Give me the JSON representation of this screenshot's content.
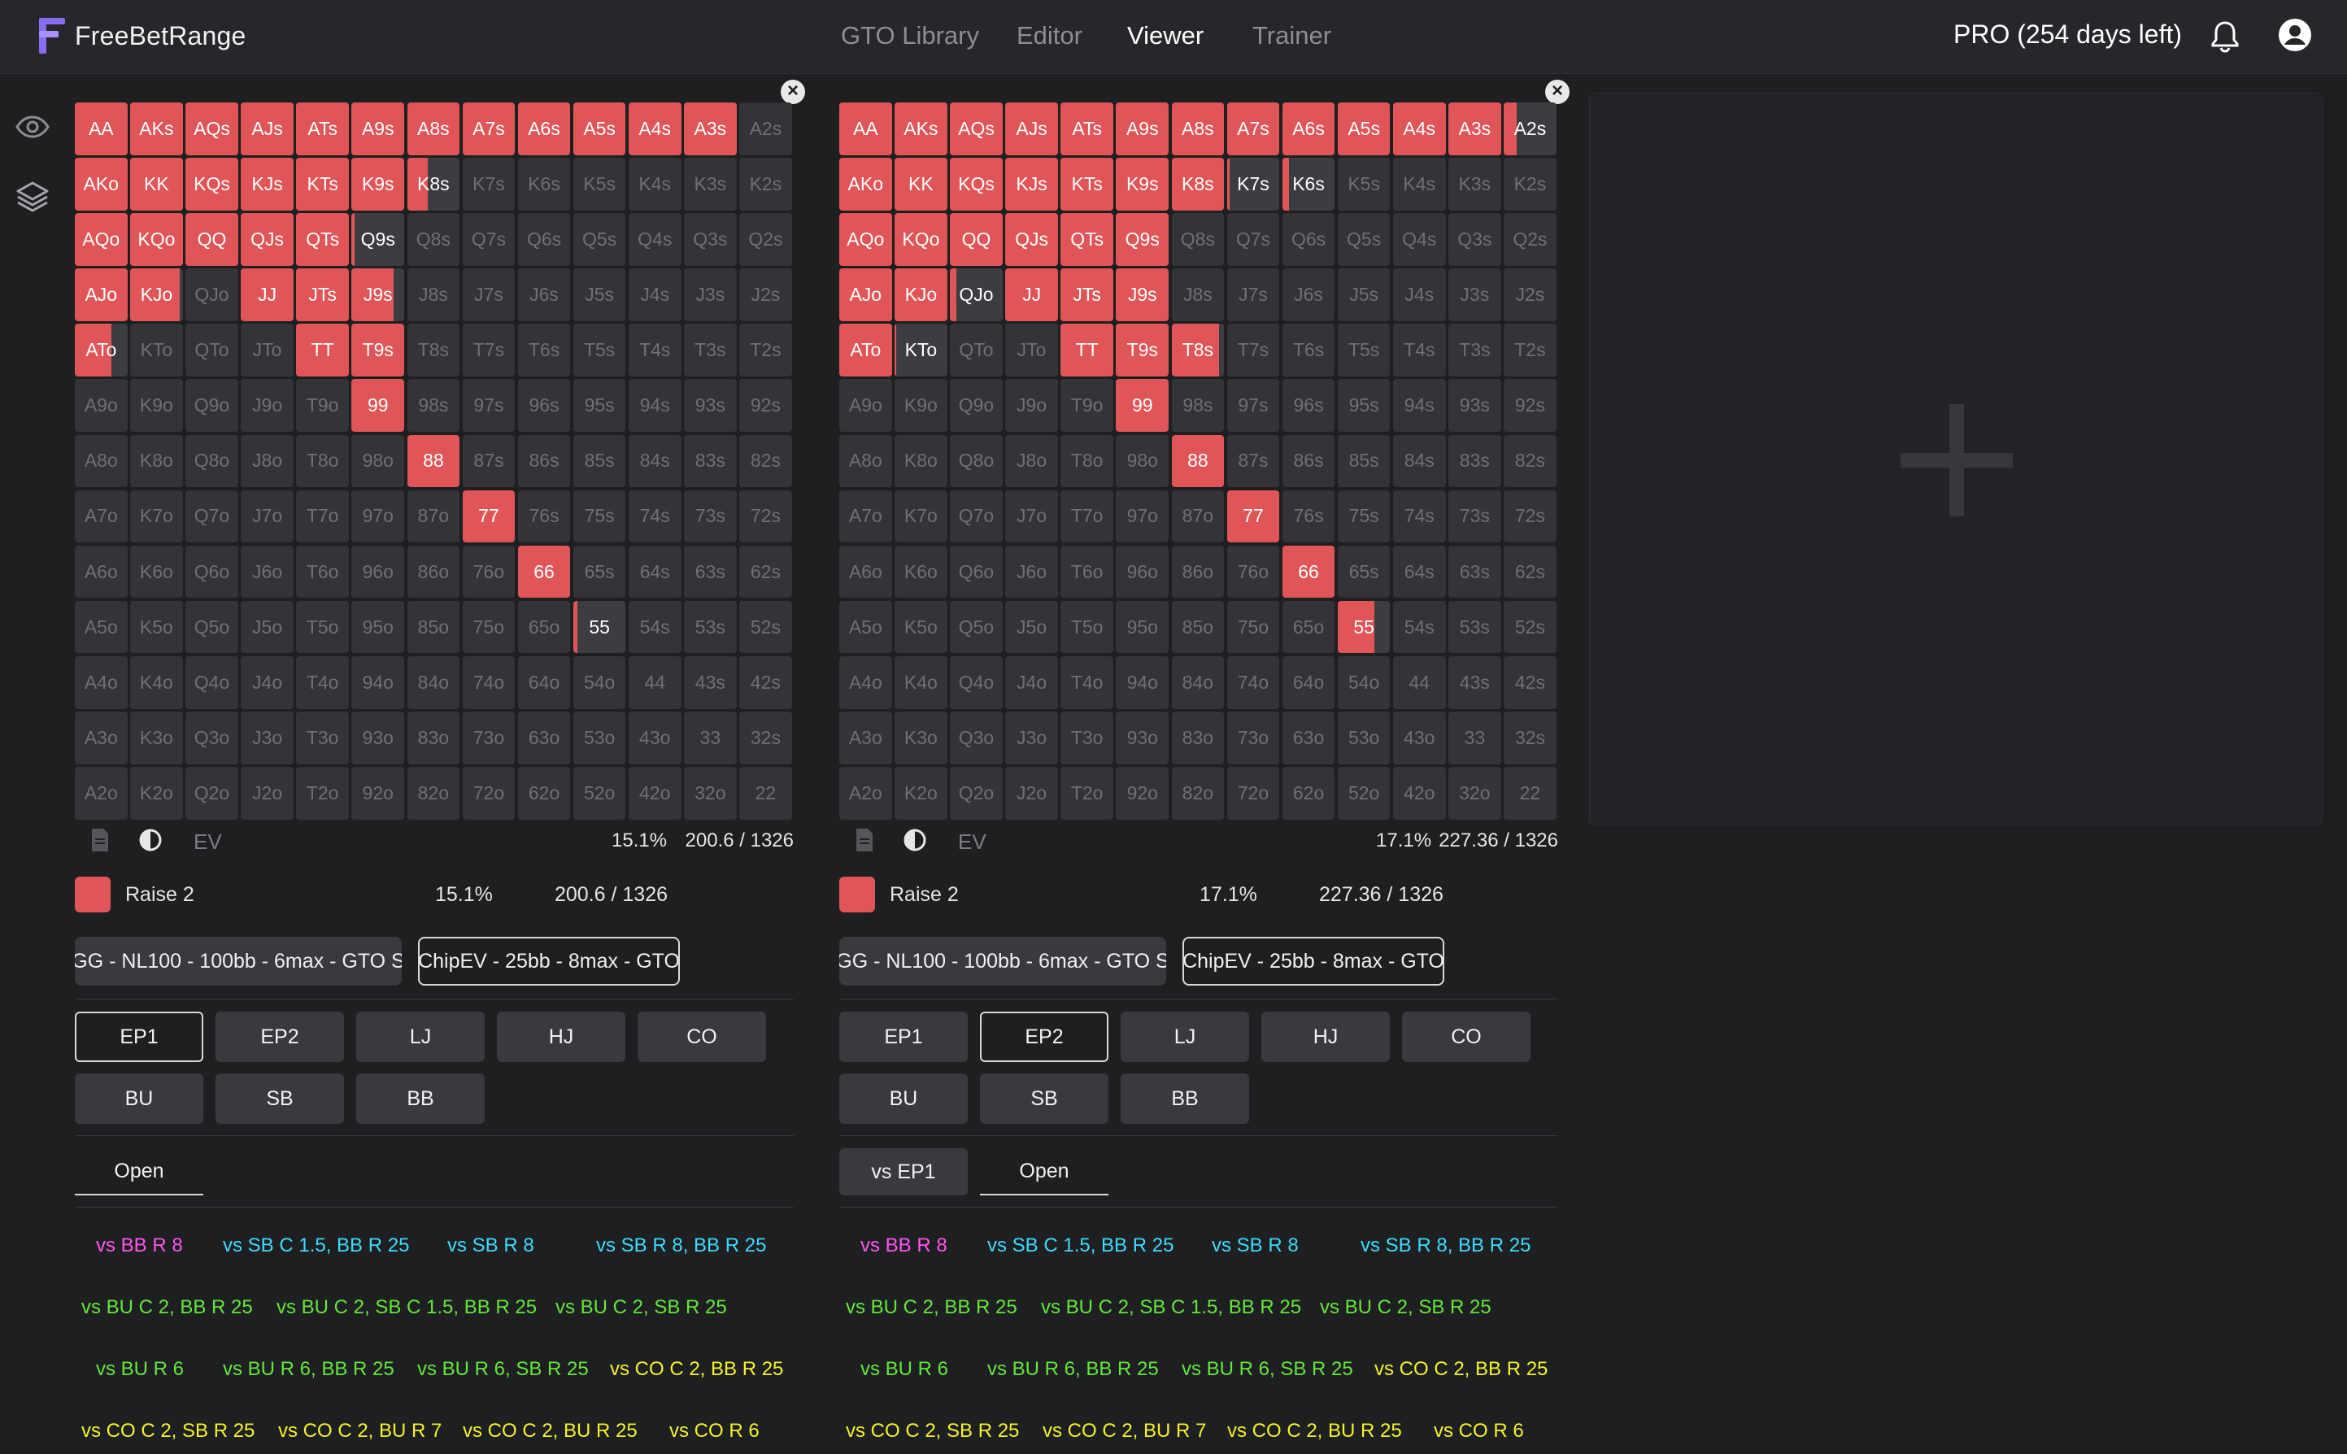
{
  "header": {
    "brand": "FreeBetRange",
    "nav": [
      "GTO Library",
      "Editor",
      "Viewer",
      "Trainer"
    ],
    "active_nav": "Viewer",
    "plan": "PRO (254 days left)"
  },
  "sidebar": {
    "icons": [
      "eye-icon",
      "layers-icon"
    ]
  },
  "colors": {
    "raise": "#e05557",
    "cell_off": "#333438",
    "bg": "#1e1f21"
  },
  "hand_grid": [
    [
      "AA",
      "AKs",
      "AQs",
      "AJs",
      "ATs",
      "A9s",
      "A8s",
      "A7s",
      "A6s",
      "A5s",
      "A4s",
      "A3s",
      "A2s"
    ],
    [
      "AKo",
      "KK",
      "KQs",
      "KJs",
      "KTs",
      "K9s",
      "K8s",
      "K7s",
      "K6s",
      "K5s",
      "K4s",
      "K3s",
      "K2s"
    ],
    [
      "AQo",
      "KQo",
      "QQ",
      "QJs",
      "QTs",
      "Q9s",
      "Q8s",
      "Q7s",
      "Q6s",
      "Q5s",
      "Q4s",
      "Q3s",
      "Q2s"
    ],
    [
      "AJo",
      "KJo",
      "QJo",
      "JJ",
      "JTs",
      "J9s",
      "J8s",
      "J7s",
      "J6s",
      "J5s",
      "J4s",
      "J3s",
      "J2s"
    ],
    [
      "ATo",
      "KTo",
      "QTo",
      "JTo",
      "TT",
      "T9s",
      "T8s",
      "T7s",
      "T6s",
      "T5s",
      "T4s",
      "T3s",
      "T2s"
    ],
    [
      "A9o",
      "K9o",
      "Q9o",
      "J9o",
      "T9o",
      "99",
      "98s",
      "97s",
      "96s",
      "95s",
      "94s",
      "93s",
      "92s"
    ],
    [
      "A8o",
      "K8o",
      "Q8o",
      "J8o",
      "T8o",
      "98o",
      "88",
      "87s",
      "86s",
      "85s",
      "84s",
      "83s",
      "82s"
    ],
    [
      "A7o",
      "K7o",
      "Q7o",
      "J7o",
      "T7o",
      "97o",
      "87o",
      "77",
      "76s",
      "75s",
      "74s",
      "73s",
      "72s"
    ],
    [
      "A6o",
      "K6o",
      "Q6o",
      "J6o",
      "T6o",
      "96o",
      "86o",
      "76o",
      "66",
      "65s",
      "64s",
      "63s",
      "62s"
    ],
    [
      "A5o",
      "K5o",
      "Q5o",
      "J5o",
      "T5o",
      "95o",
      "85o",
      "75o",
      "65o",
      "55",
      "54s",
      "53s",
      "52s"
    ],
    [
      "A4o",
      "K4o",
      "Q4o",
      "J4o",
      "T4o",
      "94o",
      "84o",
      "74o",
      "64o",
      "54o",
      "44",
      "43s",
      "42s"
    ],
    [
      "A3o",
      "K3o",
      "Q3o",
      "J3o",
      "T3o",
      "93o",
      "83o",
      "73o",
      "63o",
      "53o",
      "43o",
      "33",
      "32s"
    ],
    [
      "A2o",
      "K2o",
      "Q2o",
      "J2o",
      "T2o",
      "92o",
      "82o",
      "72o",
      "62o",
      "52o",
      "42o",
      "32o",
      "22"
    ]
  ],
  "panels": [
    {
      "raise_freq": {
        "AA": 1,
        "AKs": 1,
        "AQs": 1,
        "AJs": 1,
        "ATs": 1,
        "A9s": 1,
        "A8s": 1,
        "A7s": 1,
        "A6s": 1,
        "A5s": 1,
        "A4s": 1,
        "A3s": 1,
        "AKo": 1,
        "KK": 1,
        "KQs": 1,
        "KJs": 1,
        "KTs": 1,
        "K9s": 1,
        "K8s": 0.4,
        "AQo": 1,
        "KQo": 1,
        "QQ": 1,
        "QJs": 1,
        "QTs": 1,
        "Q9s": 0.05,
        "AJo": 1,
        "KJo": 0.95,
        "JJ": 1,
        "JTs": 1,
        "J9s": 0.8,
        "ATo": 0.7,
        "TT": 1,
        "T9s": 1,
        "99": 1,
        "88": 1,
        "77": 1,
        "66": 1,
        "55": 0.08
      },
      "sub_on": [
        "Q9s",
        "55"
      ],
      "ev_label": "EV",
      "footer_pct": "15.1%",
      "footer_combos": "200.6 / 1326",
      "legend": {
        "label": "Raise 2",
        "pct": "15.1%",
        "combos": "200.6 / 1326"
      },
      "range_tabs": [
        "GG - NL100 - 100bb - 6max - GTO S",
        "ChipEV - 25bb - 8max - GTO"
      ],
      "range_tab_selected": 1,
      "positions": [
        "EP1",
        "EP2",
        "LJ",
        "HJ",
        "CO",
        "BU",
        "SB",
        "BB"
      ],
      "position_selected": "EP1",
      "situation_tabs": [
        "Open"
      ],
      "situation_selected": "Open",
      "actions": [
        [
          {
            "t": "vs BB R 8",
            "c": "pink"
          },
          {
            "t": "vs SB C 1.5, BB R 25",
            "c": "cyan"
          },
          {
            "t": "vs SB R 8",
            "c": "cyan"
          },
          {
            "t": "vs SB R 8, BB R 25",
            "c": "cyan"
          }
        ],
        [
          {
            "t": "vs BU C 2, BB R 25",
            "c": "green"
          },
          {
            "t": "vs BU C 2, SB C 1.5, BB R 25",
            "c": "green"
          },
          {
            "t": "vs BU C 2, SB R 25",
            "c": "green"
          }
        ],
        [
          {
            "t": "vs BU R 6",
            "c": "green"
          },
          {
            "t": "vs BU R 6, BB R 25",
            "c": "green"
          },
          {
            "t": "vs BU R 6, SB R 25",
            "c": "green"
          },
          {
            "t": "vs CO C 2, BB R 25",
            "c": "yellow"
          }
        ],
        [
          {
            "t": "vs CO C 2, SB R 25",
            "c": "yellow"
          },
          {
            "t": "vs CO C 2, BU R 7",
            "c": "yellow"
          },
          {
            "t": "vs CO C 2, BU R 25",
            "c": "yellow"
          },
          {
            "t": "vs CO R 6",
            "c": "yellow"
          }
        ]
      ]
    },
    {
      "raise_freq": {
        "AA": 1,
        "AKs": 1,
        "AQs": 1,
        "AJs": 1,
        "ATs": 1,
        "A9s": 1,
        "A8s": 1,
        "A7s": 1,
        "A6s": 1,
        "A5s": 1,
        "A4s": 1,
        "A3s": 1,
        "A2s": 0.25,
        "AKo": 1,
        "KK": 1,
        "KQs": 1,
        "KJs": 1,
        "KTs": 1,
        "K9s": 1,
        "K8s": 1,
        "K7s": 0.05,
        "K6s": 0.12,
        "AQo": 1,
        "KQo": 1,
        "QQ": 1,
        "QJs": 1,
        "QTs": 1,
        "Q9s": 1,
        "AJo": 1,
        "KJo": 1,
        "QJo": 0.12,
        "JJ": 1,
        "JTs": 1,
        "J9s": 1,
        "ATo": 1,
        "KTo": 0.03,
        "TT": 1,
        "T9s": 1,
        "T8s": 0.9,
        "99": 1,
        "88": 1,
        "77": 1,
        "66": 1,
        "55": 0.7
      },
      "sub_on": [
        "K7s",
        "K6s",
        "QJo",
        "KTo",
        "A2s"
      ],
      "ev_label": "EV",
      "footer_pct": "17.1%",
      "footer_combos": "227.36 / 1326",
      "legend": {
        "label": "Raise 2",
        "pct": "17.1%",
        "combos": "227.36 / 1326"
      },
      "range_tabs": [
        "GG - NL100 - 100bb - 6max - GTO S",
        "ChipEV - 25bb - 8max - GTO"
      ],
      "range_tab_selected": 1,
      "positions": [
        "EP1",
        "EP2",
        "LJ",
        "HJ",
        "CO",
        "BU",
        "SB",
        "BB"
      ],
      "position_selected": "EP2",
      "situation_tabs": [
        "vs EP1",
        "Open"
      ],
      "situation_selected": "Open",
      "actions": [
        [
          {
            "t": "vs BB R 8",
            "c": "pink"
          },
          {
            "t": "vs SB C 1.5, BB R 25",
            "c": "cyan"
          },
          {
            "t": "vs SB R 8",
            "c": "cyan"
          },
          {
            "t": "vs SB R 8, BB R 25",
            "c": "cyan"
          }
        ],
        [
          {
            "t": "vs BU C 2, BB R 25",
            "c": "green"
          },
          {
            "t": "vs BU C 2, SB C 1.5, BB R 25",
            "c": "green"
          },
          {
            "t": "vs BU C 2, SB R 25",
            "c": "green"
          }
        ],
        [
          {
            "t": "vs BU R 6",
            "c": "green"
          },
          {
            "t": "vs BU R 6, BB R 25",
            "c": "green"
          },
          {
            "t": "vs BU R 6, SB R 25",
            "c": "green"
          },
          {
            "t": "vs CO C 2, BB R 25",
            "c": "yellow"
          }
        ],
        [
          {
            "t": "vs CO C 2, SB R 25",
            "c": "yellow"
          },
          {
            "t": "vs CO C 2, BU R 7",
            "c": "yellow"
          },
          {
            "t": "vs CO C 2, BU R 25",
            "c": "yellow"
          },
          {
            "t": "vs CO R 6",
            "c": "yellow"
          }
        ]
      ]
    }
  ],
  "empty_slot": {
    "icon": "plus-icon"
  }
}
